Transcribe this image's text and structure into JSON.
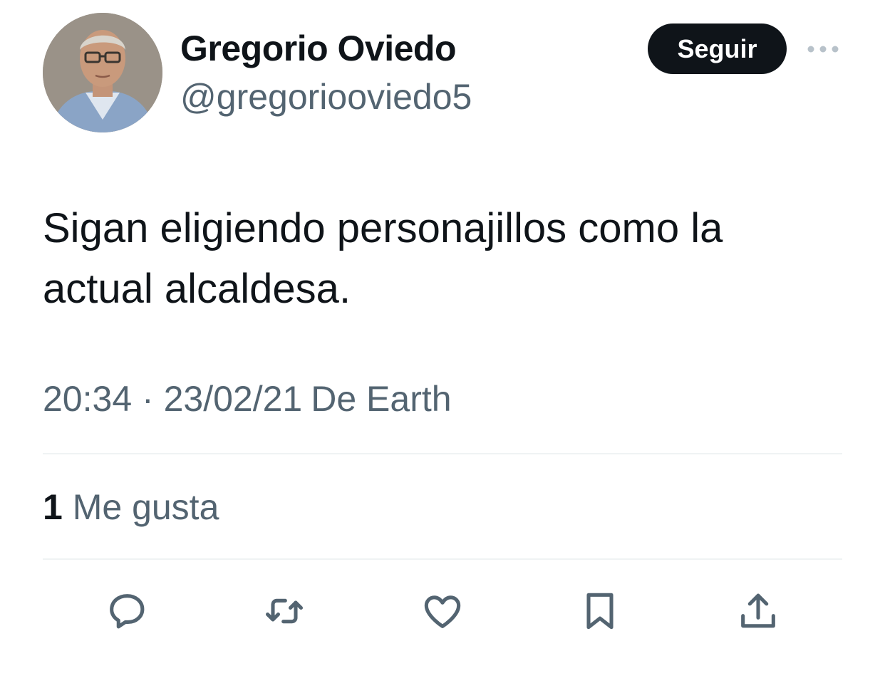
{
  "author": {
    "name": "Gregorio Oviedo",
    "handle": "@gregorioovied o5"
  },
  "follow_button": {
    "label": "Seguir"
  },
  "tweet": {
    "text": "Sigan eligiendo personajillos como la actual alcaldesa."
  },
  "meta": {
    "time": "20:34",
    "separator": "·",
    "date": "23/02/21",
    "source": "De Earth"
  },
  "likes": {
    "count": "1",
    "label": "Me gusta"
  },
  "actions": [
    {
      "icon": "reply-icon"
    },
    {
      "icon": "retweet-icon"
    },
    {
      "icon": "like-icon"
    },
    {
      "icon": "bookmark-icon"
    },
    {
      "icon": "share-icon"
    }
  ],
  "colors": {
    "primary_text": "#0f1419",
    "secondary_text": "#536471",
    "divider": "#eff3f4",
    "follow_button_bg": "#0f1419"
  }
}
